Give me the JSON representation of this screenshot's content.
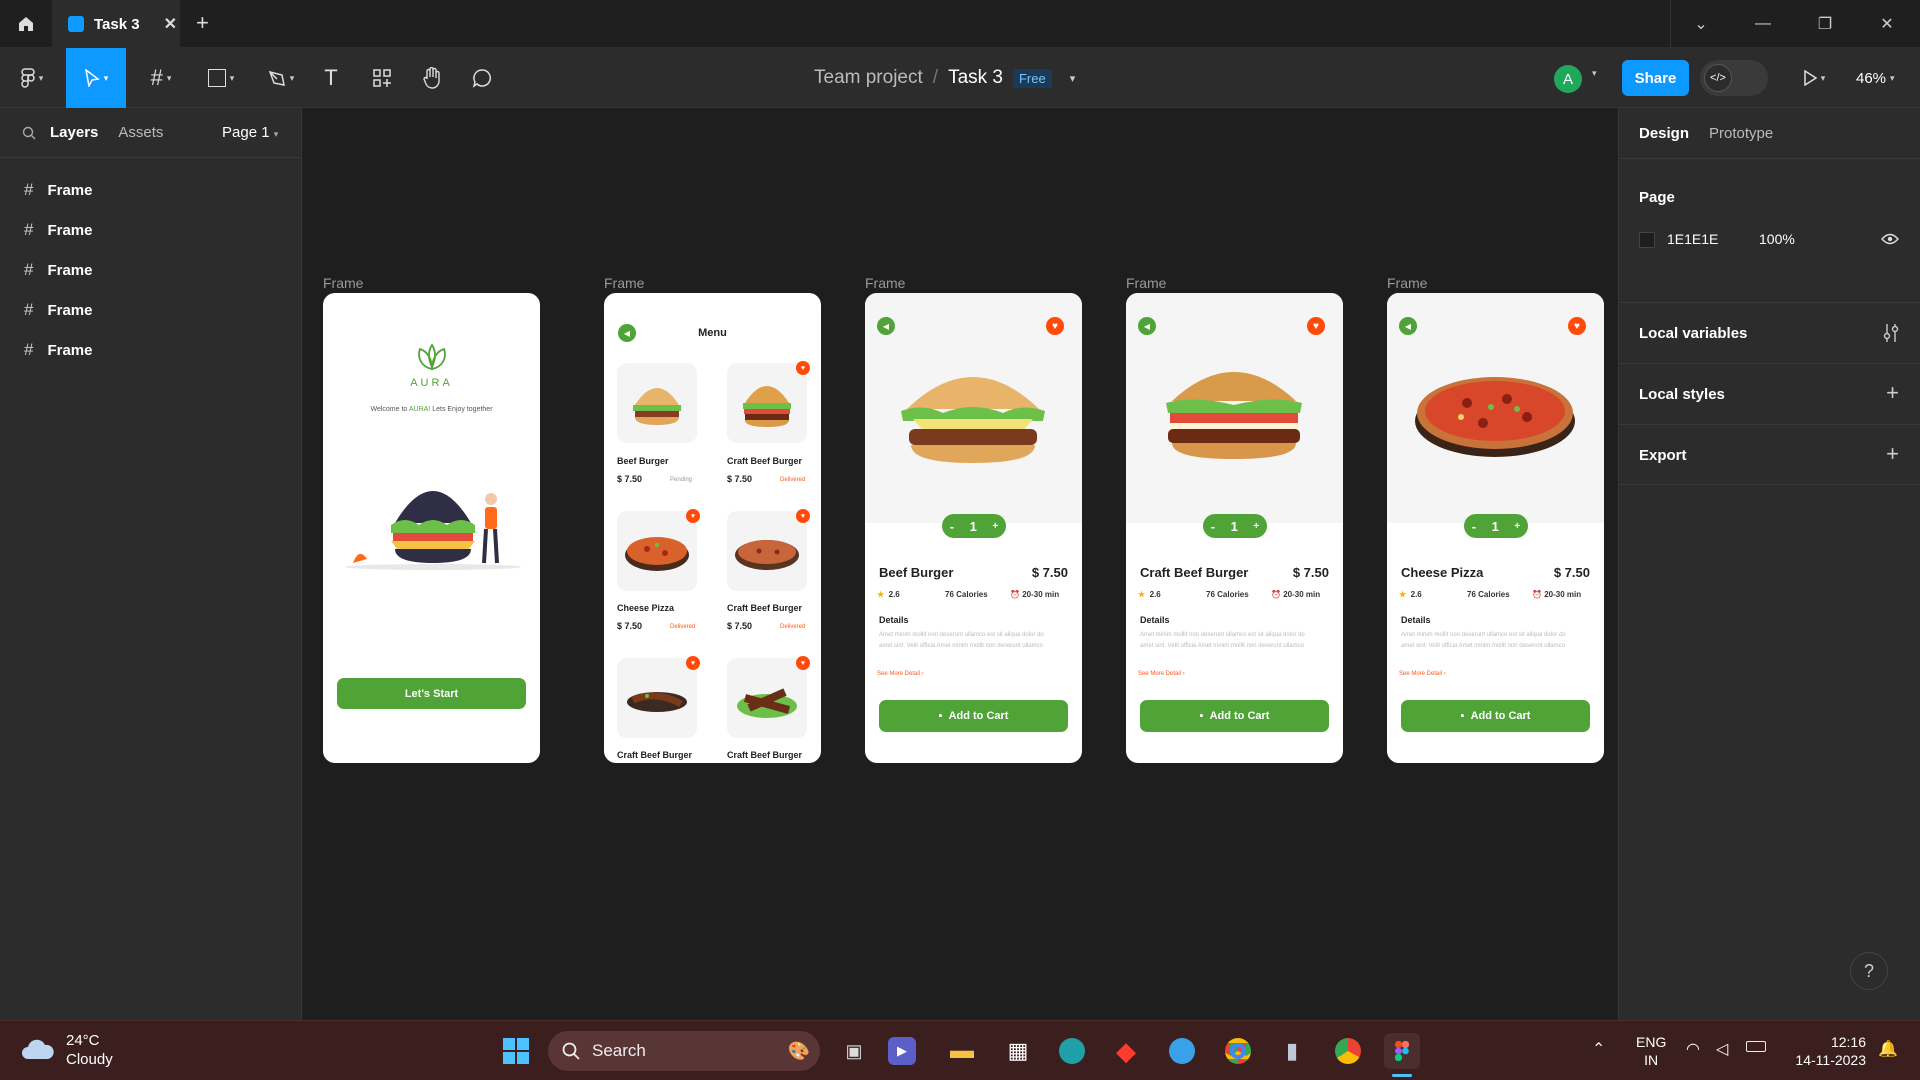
{
  "titlebar": {
    "tab_title": "Task 3"
  },
  "toolbar": {
    "project": "Team project",
    "separator": "/",
    "file": "Task 3",
    "plan_badge": "Free",
    "avatar_letter": "A",
    "share_label": "Share",
    "dev_mode_label": "</>",
    "zoom": "46%"
  },
  "left_panel": {
    "tabs": [
      "Layers",
      "Assets"
    ],
    "page": "Page 1",
    "layers": [
      "Frame",
      "Frame",
      "Frame",
      "Frame",
      "Frame"
    ]
  },
  "right_panel": {
    "tabs": [
      "Design",
      "Prototype"
    ],
    "page_title": "Page",
    "page_color": "1E1E1E",
    "page_opacity": "100%",
    "local_variables": "Local variables",
    "local_styles": "Local styles",
    "export": "Export",
    "help": "?"
  },
  "canvas": {
    "frame_label": "Frame",
    "welcome": {
      "brand": "AURA",
      "tagline_prefix": "Welcome to ",
      "tagline_brand": "AURA!",
      "tagline_suffix": " Lets Enjoy together",
      "start_button": "Let's Start"
    },
    "menu": {
      "title": "Menu",
      "items": [
        {
          "name": "Beef Burger",
          "price": "$ 7.50",
          "status": "Pending"
        },
        {
          "name": "Craft Beef Burger",
          "price": "$ 7.50",
          "status": "Delivered"
        },
        {
          "name": "Cheese Pizza",
          "price": "$ 7.50",
          "status": "Delivered"
        },
        {
          "name": "Craft Beef Burger",
          "price": "$ 7.50",
          "status": "Delivered"
        },
        {
          "name": "Craft Beef Burger",
          "price": "",
          "status": ""
        },
        {
          "name": "Craft Beef Burger",
          "price": "",
          "status": ""
        }
      ]
    },
    "details": [
      {
        "name": "Beef Burger",
        "price": "$ 7.50",
        "qty": "1",
        "rating": "2.6",
        "calories": "76 Calories",
        "time": "20-30 min"
      },
      {
        "name": "Craft Beef Burger",
        "price": "$ 7.50",
        "qty": "1",
        "rating": "2.6",
        "calories": "76 Calories",
        "time": "20-30 min"
      },
      {
        "name": "Cheese Pizza",
        "price": "$ 7.50",
        "qty": "1",
        "rating": "2.6",
        "calories": "76 Calories",
        "time": "20-30 min"
      }
    ],
    "details_title": "Details",
    "details_text": "Amet minim mollit non deserunt ullamco est sit aliqua dolor do amet sint. Velit officia Amet minim mollit non deserunt ullamco",
    "see_more": "See More Detail",
    "add_to_cart": "Add to Cart",
    "minus": "-",
    "plus": "+"
  },
  "taskbar": {
    "weather_temp": "24°C",
    "weather_cond": "Cloudy",
    "search": "Search",
    "lang": "ENG",
    "region": "IN",
    "time": "12:16",
    "date": "14-11-2023"
  },
  "colors": {
    "accent": "#0d99ff",
    "app_green": "#4fa337",
    "app_orange": "#ff4a0a",
    "canvas_bg": "#1e1e1e",
    "taskbar": "#3b1f1f"
  }
}
